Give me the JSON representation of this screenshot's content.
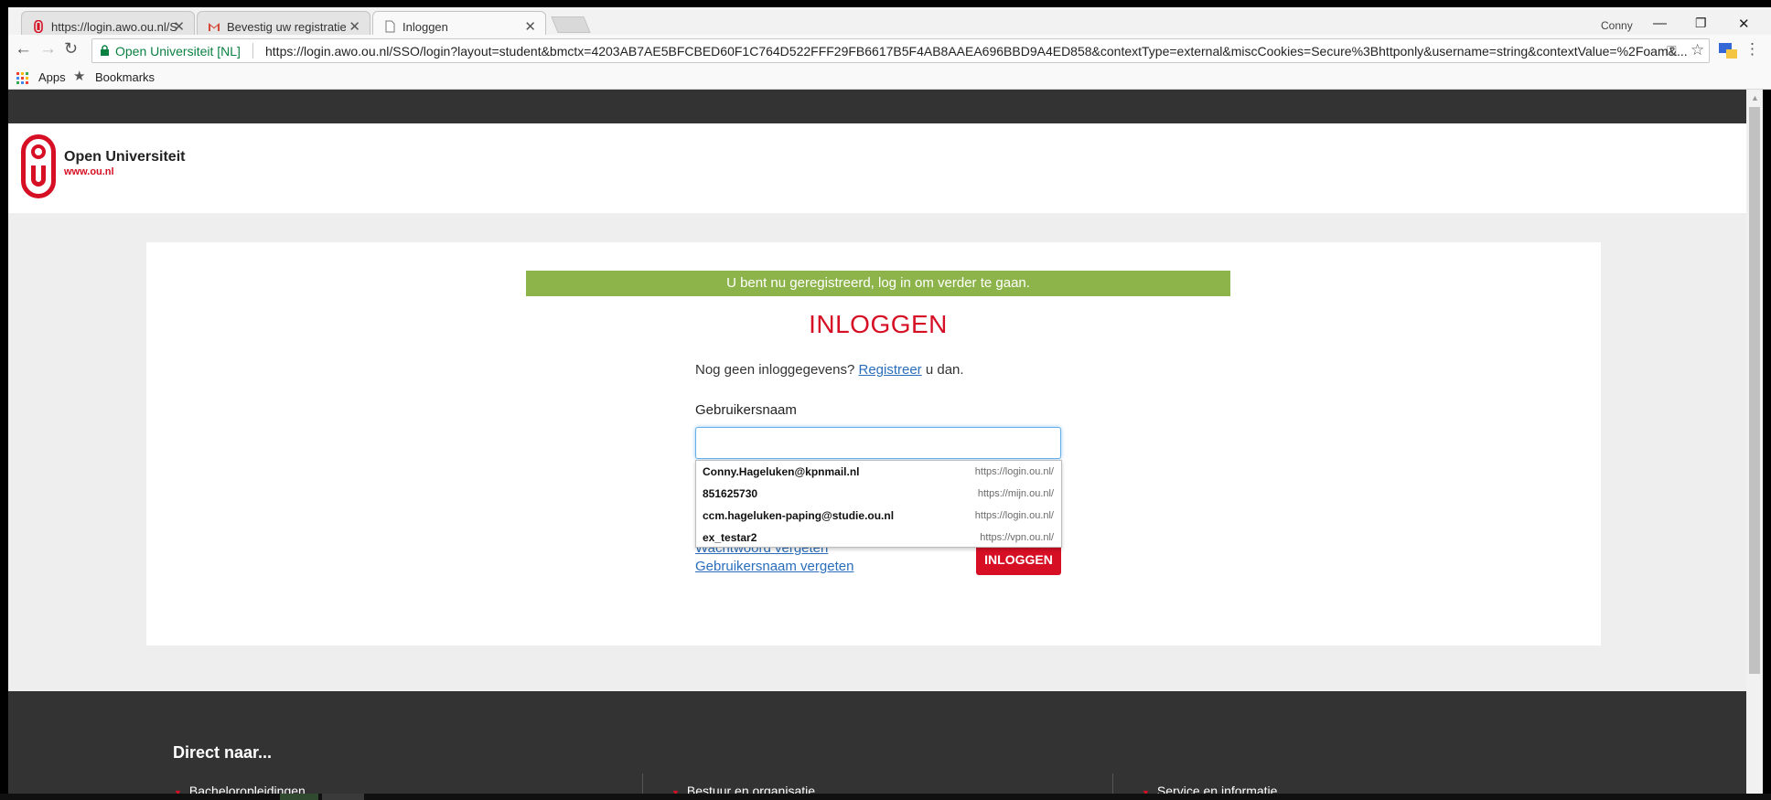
{
  "browser": {
    "tabs": [
      {
        "title": "https://login.awo.ou.nl/S",
        "favicon": "ou-logo-icon"
      },
      {
        "title": "Bevestig uw registratie -",
        "favicon": "gmail-icon"
      },
      {
        "title": "Inloggen",
        "favicon": "page-icon"
      }
    ],
    "profile_name": "Conny",
    "security_label": "Open Universiteit [NL]",
    "url": "https://login.awo.ou.nl/SSO/login?layout=student&bmctx=4203AB7AE5BFCBED60F1C764D522FFF29FB6617B5F4AB8AAEA696BBD9A4ED858&contextType=external&miscCookies=Secure%3Bhttponly&username=string&contextValue=%2Foam&...",
    "bookmarks": {
      "apps_label": "Apps",
      "bookmarks_label": "Bookmarks"
    }
  },
  "site": {
    "logo_name": "Open Universiteit",
    "logo_url": "www.ou.nl",
    "brand_color": "#d60f24",
    "success_color": "#8db44a"
  },
  "login": {
    "banner": "U bent nu geregistreerd, log in om verder te gaan.",
    "title": "INLOGGEN",
    "register_prefix": "Nog geen inloggegevens?",
    "register_link": "Registreer",
    "register_suffix": "u dan.",
    "username_label": "Gebruikersnaam",
    "username_value": "",
    "forgot_password": "Wachtwoord vergeten",
    "forgot_username": "Gebruikersnaam vergeten",
    "login_button": "INLOGGEN"
  },
  "autocomplete": [
    {
      "user": "Conny.Hageluken@kpnmail.nl",
      "site": "https://login.ou.nl/"
    },
    {
      "user": "851625730",
      "site": "https://mijn.ou.nl/"
    },
    {
      "user": "ccm.hageluken-paping@studie.ou.nl",
      "site": "https://login.ou.nl/"
    },
    {
      "user": "ex_testar2",
      "site": "https://vpn.ou.nl/"
    }
  ],
  "footer": {
    "title": "Direct naar...",
    "columns": [
      "Bacheloropleidingen",
      "Bestuur en organisatie",
      "Service en informatie"
    ]
  }
}
